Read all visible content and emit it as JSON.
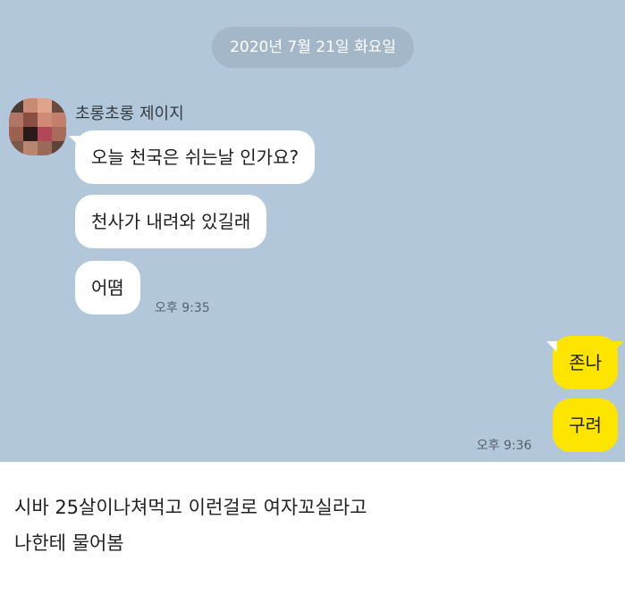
{
  "chat": {
    "date": "2020년 7월 21일 화요일",
    "sender": {
      "name": "초롱초롱 제이지",
      "messages": [
        "오늘 천국은 쉬는날 인가요?",
        "천사가 내려와 있길래",
        "어뗨"
      ],
      "time": "오후 9:35"
    },
    "me": {
      "messages": [
        "존나",
        "구려"
      ],
      "time": "오후 9:36"
    }
  },
  "caption": {
    "lines": [
      "시바 25살이나쳐먹고 이런걸로 여자꼬실라고",
      "나한테 물어봄"
    ]
  },
  "colors": {
    "chat_background": "#b2c7da",
    "my_bubble": "#fee500",
    "their_bubble": "#ffffff"
  }
}
